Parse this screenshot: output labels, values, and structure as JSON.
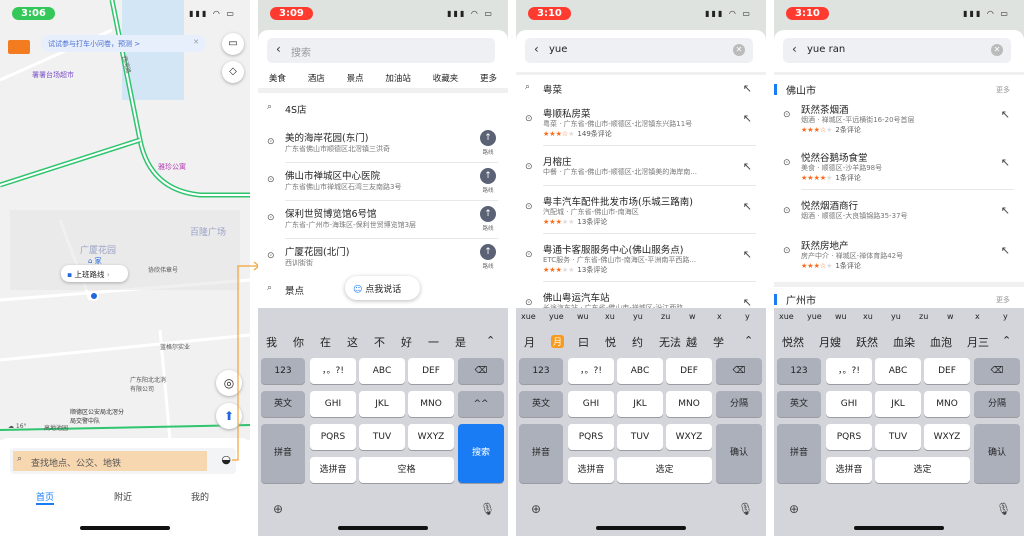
{
  "colors": {
    "accent": "#1a7cf5",
    "star": "#ff6a1a",
    "time_green": "#34c759",
    "time_red": "#ff3b30",
    "highlight": "#f6d7b0",
    "connector": "#f2a33a"
  },
  "screen1": {
    "time": "3:06",
    "banner": "试试参与打车小问卷，预测 >",
    "pois": [
      {
        "label": "署署台场超市"
      },
      {
        "label": "雅珍公寓"
      },
      {
        "label": "百隆广场"
      },
      {
        "label": "广厦花园"
      },
      {
        "label": "家"
      },
      {
        "label": "协欣伟章号"
      },
      {
        "label": "蓝格尔实业"
      },
      {
        "label": "广东阳北北消有限公司"
      },
      {
        "label": "顺德区公安局北滘分局交警中队"
      }
    ],
    "road_label": "西湾路",
    "route_chip": "上班路线",
    "weather": "16°",
    "bottom_poi": "高地池园",
    "search_placeholder": "查找地点、公交、地铁",
    "tabs": [
      {
        "label": "首页",
        "active": true
      },
      {
        "label": "附近"
      },
      {
        "label": "我的"
      }
    ]
  },
  "screen2": {
    "time": "3:09",
    "search_placeholder": "搜索",
    "categories": [
      "美食",
      "酒店",
      "景点",
      "加油站",
      "收藏夹",
      "更多"
    ],
    "history_top": "4S店",
    "items": [
      {
        "name": "美的海岸花园(东门)",
        "addr": "广东省佛山市顺德区北滘镇三洪奇",
        "route": "路线"
      },
      {
        "name": "佛山市禅城区中心医院",
        "addr": "广东省佛山市禅城区石湾三友南路3号",
        "route": "路线"
      },
      {
        "name": "保利世贸博览馆6号馆",
        "addr": "广东省-广州市-海珠区-保利世贸博览馆3层",
        "route": "路线"
      },
      {
        "name": "广厦花园(北门)",
        "addr": "西训街街",
        "route": "路线"
      }
    ],
    "history_bottom": "景点",
    "voice_button": "点我说话",
    "candidates": [
      "我",
      "你",
      "在",
      "这",
      "不",
      "好",
      "一",
      "是"
    ],
    "keys": {
      "r1": [
        "123",
        "，。?!",
        "ABC",
        "DEF",
        "⌫"
      ],
      "r2": [
        "英文",
        "GHI",
        "JKL",
        "MNO",
        "^^"
      ],
      "r3": [
        "拼音",
        "PQRS",
        "TUV",
        "WXYZ",
        "搜索"
      ],
      "r4": [
        "选拼音",
        "空格"
      ]
    }
  },
  "screen3": {
    "time": "3:10",
    "query": "yue",
    "suggest": "粤菜",
    "items": [
      {
        "name": "粤顺私房菜",
        "addr": "粤菜 · 广东省-佛山市-顺德区-北滘镇东兴路11号",
        "rating": 3.5,
        "reviews": "149条评论"
      },
      {
        "name": "月榕庄",
        "addr": "中餐 · 广东省-佛山市-顺德区-北滘镇美的海岸南...",
        "rating": null,
        "reviews": ""
      },
      {
        "name": "粤丰汽车配件批发市场(乐城三路南)",
        "addr": "汽配城 · 广东省-佛山市-南海区",
        "rating": 3,
        "reviews": "13条评论"
      },
      {
        "name": "粤通卡客服服务中心(佛山服务点)",
        "addr": "ETC服务 · 广东省-佛山市-南海区-平洲南平西路...",
        "rating": 3,
        "reviews": "13条评论"
      },
      {
        "name": "佛山粤运汽车站",
        "addr": "长途汽车站 · 广东省-佛山市-禅城区-汾江西路",
        "rating": null,
        "reviews": ""
      }
    ],
    "pinyin": [
      "xue",
      "yue",
      "wu",
      "xu",
      "yu",
      "zu",
      "w",
      "x",
      "y"
    ],
    "candidates": [
      "月",
      "月",
      "曰",
      "悦",
      "约",
      "无法",
      "越",
      "学"
    ],
    "keys": {
      "r1": [
        "123",
        "，。?!",
        "ABC",
        "DEF",
        "⌫"
      ],
      "r2": [
        "英文",
        "GHI",
        "JKL",
        "MNO",
        "分隔"
      ],
      "r3": [
        "拼音",
        "PQRS",
        "TUV",
        "WXYZ",
        "确认"
      ],
      "r4": [
        "选拼音",
        "选定"
      ]
    }
  },
  "screen4": {
    "time": "3:10",
    "query": "yue ran",
    "sections": [
      {
        "title": "佛山市",
        "more": "更多",
        "items": [
          {
            "name": "跃然茶烟酒",
            "addr": "烟酒 · 禅城区-平远横街16-20号首层",
            "rating": 3.5,
            "reviews": "2条评论"
          },
          {
            "name": "悦然谷鹅场食堂",
            "addr": "美食 · 顺德区-沙羊路98号",
            "rating": 4,
            "reviews": "1条评论"
          },
          {
            "name": "悦然烟酒商行",
            "addr": "烟酒 · 顺德区-大良镇锦路35-37号",
            "rating": null,
            "reviews": ""
          },
          {
            "name": "跃然房地产",
            "addr": "房产中介 · 禅城区-禅体育路42号",
            "rating": 3.5,
            "reviews": "1条评论"
          }
        ]
      },
      {
        "title": "广州市",
        "more": "更多",
        "items": []
      }
    ],
    "pinyin": [
      "xue",
      "yue",
      "wu",
      "xu",
      "yu",
      "zu",
      "w",
      "x",
      "y"
    ],
    "candidates": [
      "悦然",
      "月嫂",
      "跃然",
      "血染",
      "血泡",
      "月三"
    ],
    "keys": {
      "r1": [
        "123",
        "，。?!",
        "ABC",
        "DEF",
        "⌫"
      ],
      "r2": [
        "英文",
        "GHI",
        "JKL",
        "MNO",
        "分隔"
      ],
      "r3": [
        "拼音",
        "PQRS",
        "TUV",
        "WXYZ",
        "确认"
      ],
      "r4": [
        "选拼音",
        "选定"
      ]
    }
  },
  "icons": {
    "search": "search-icon",
    "pin": "location-pin-icon",
    "back": "back-arrow-icon",
    "fill": "arrow-up-left-icon",
    "globe": "globe-icon",
    "mic": "microphone-icon"
  }
}
